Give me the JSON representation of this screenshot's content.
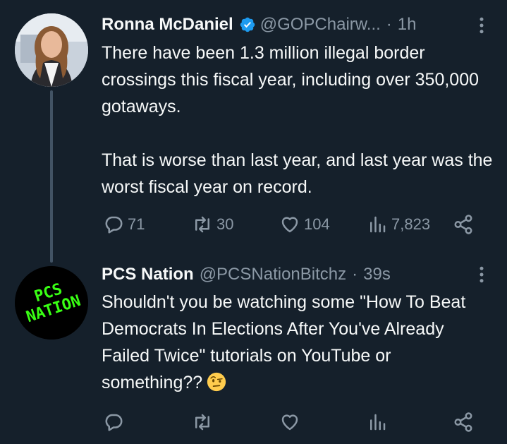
{
  "tweets": [
    {
      "name": "Ronna McDaniel",
      "handle": "@GOPChairw...",
      "dot": "·",
      "time": "1h",
      "text_p1": "There have been 1.3 million illegal border crossings this fiscal year, including over 350,000 gotaways.",
      "text_p2": "That is worse than last year, and last year was the worst fiscal year on record.",
      "replies": "71",
      "retweets": "30",
      "likes": "104",
      "views": "7,823"
    },
    {
      "name": "PCS Nation",
      "handle": "@PCSNationBitchz",
      "dot": "·",
      "time": "39s",
      "avatar_text": "PCS NATION",
      "text": "Shouldn't you be watching some \"How To Beat Democrats In Elections After You've Already Failed Twice\" tutorials on YouTube or something??",
      "emoji_name": "face-with-raised-eyebrow-emoji"
    }
  ],
  "colors": {
    "background": "#15202b",
    "text": "#f7f9f9",
    "secondary": "#8b98a5",
    "verified": "#1d9bf0",
    "avatar_logo": "#39ff14",
    "thread_line": "#425364"
  }
}
